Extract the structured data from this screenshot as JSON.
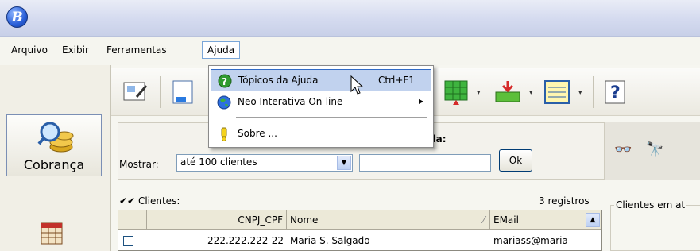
{
  "window": {
    "app_icon_letter": "B"
  },
  "menubar": {
    "items": [
      {
        "label": "Arquivo"
      },
      {
        "label": "Exibir"
      },
      {
        "label": "Ferramentas"
      },
      {
        "label": "Ajuda"
      }
    ]
  },
  "ajuda_menu": {
    "items": [
      {
        "label": "Tópicos da Ajuda",
        "shortcut": "Ctrl+F1",
        "icon": "help-icon",
        "highlighted": true
      },
      {
        "label": "Neo Interativa On-line",
        "icon": "globe-icon",
        "submenu": true
      },
      {
        "label": "Sobre ...",
        "icon": "exclamation-icon"
      }
    ]
  },
  "sidebar": {
    "items": [
      {
        "label": "Cobrança",
        "icon": "coins-magnifier-icon"
      }
    ]
  },
  "filter": {
    "mostrar_label": "Mostrar:",
    "mostrar_value": "até 100 clientes",
    "busca_label_fragment": "da:",
    "ok_label": "Ok"
  },
  "clientes": {
    "header": "Clientes:",
    "count_text": "3 registros",
    "columns": [
      "CNPJ_CPF",
      "Nome",
      "EMail"
    ],
    "rows": [
      {
        "cnpj_cpf": "222.222.222-22",
        "nome": "Maria S. Salgado",
        "email": "mariass@maria"
      }
    ]
  },
  "side_panel": {
    "title": "Clientes em at"
  },
  "colors": {
    "highlight": "#c1d2ee",
    "highlight_border": "#316ac5",
    "titlebar": "#d4daef"
  }
}
